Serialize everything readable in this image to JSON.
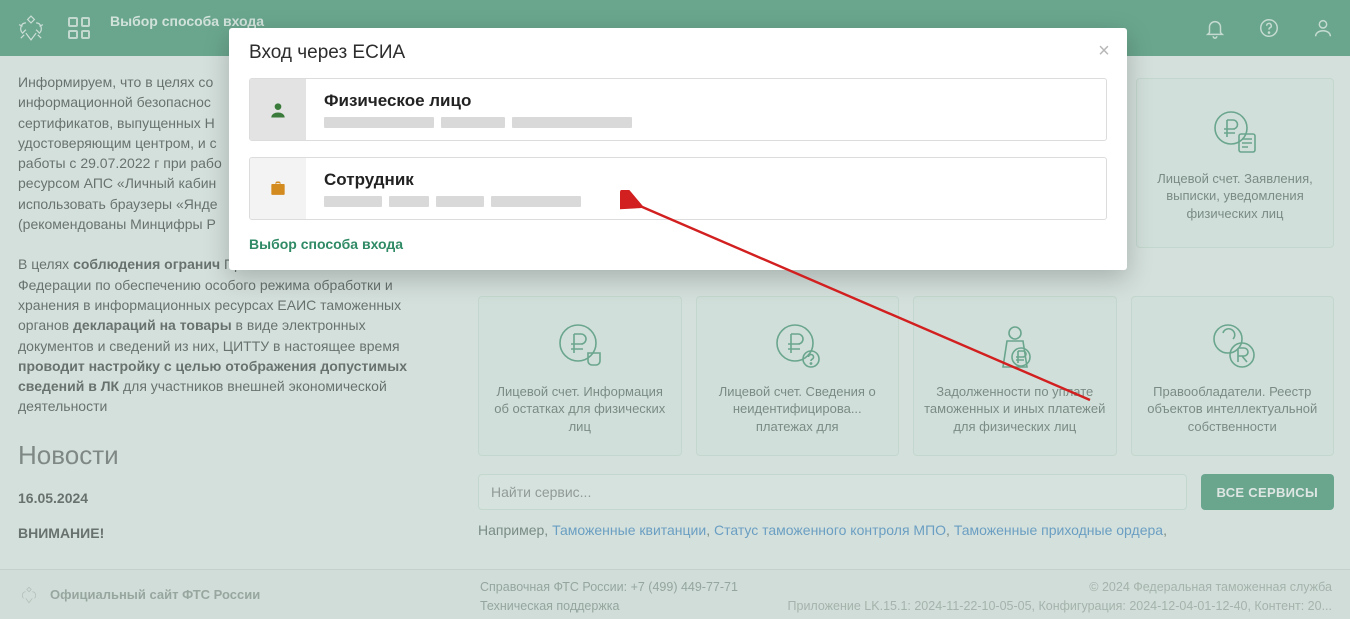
{
  "topbar": {
    "title": "Выбор способа входа"
  },
  "left": {
    "p1_a": "Информируем, что в целях со",
    "p1_b": "информационной безопаснос",
    "p1_c": "сертификатов, выпущенных Н",
    "p1_d": "удостоверяющим центром, и с",
    "p1_e": "работы с 29.07.2022 г при рабо",
    "p1_f": "ресурсом АПС «Личный кабин",
    "p1_g": "использовать браузеры «Янде",
    "p1_h": "(рекомендованы Минцифры Р",
    "p2_a": "В целях ",
    "p2_b": "соблюдения огранич",
    "p2_c": " Правительством Российской Федерации по обеспечению особого режима обработки и хранения в информационных ресурсах ЕАИС таможенных органов ",
    "p2_d": "деклараций на товары",
    "p2_e": " в виде электронных документов и сведений из них, ЦИТТУ в настоящее время ",
    "p2_f": "проводит настройку с целью отображения допустимых  сведений в  ЛК",
    "p2_g": " для участников внешней экономической деятельности",
    "news_h": "Новости",
    "news_date": "16.05.2024",
    "news_title": "ВНИМАНИЕ!"
  },
  "cards": [
    {
      "label": "Лицевой счет. Информация об остатках для физических лиц"
    },
    {
      "label": "Лицевой счет. Сведения о неидентифицирова... платежах для"
    },
    {
      "label": "Задолженности по уплате таможенных и иных платежей для физических лиц"
    },
    {
      "label": "Правообладатели. Реестр объектов интеллектуальной собственности"
    }
  ],
  "card_top": {
    "label": "Лицевой счет. Заявления, выписки, уведомления физических лиц"
  },
  "search": {
    "placeholder": "Найти сервис...",
    "btn": "ВСЕ СЕРВИСЫ"
  },
  "eg": {
    "prefix": "Например, ",
    "a1": "Таможенные квитанции",
    "a2": "Статус таможенного контроля МПО",
    "a3": "Таможенные приходные ордера"
  },
  "footer": {
    "left": "Официальный сайт ФТС России",
    "mid1": "Справочная ФТС России: +7 (499) 449-77-71",
    "mid2": "Техническая поддержка",
    "r1": "© 2024 Федеральная таможенная служба",
    "r2": "Приложение LK.15.1: 2024-11-22-10-05-05, Конфигурация: 2024-12-04-01-12-40, Контент: 20..."
  },
  "modal": {
    "title": "Вход через ЕСИА",
    "opt1": "Физическое лицо",
    "opt2": "Сотрудник",
    "chooser": "Выбор способа входа"
  }
}
